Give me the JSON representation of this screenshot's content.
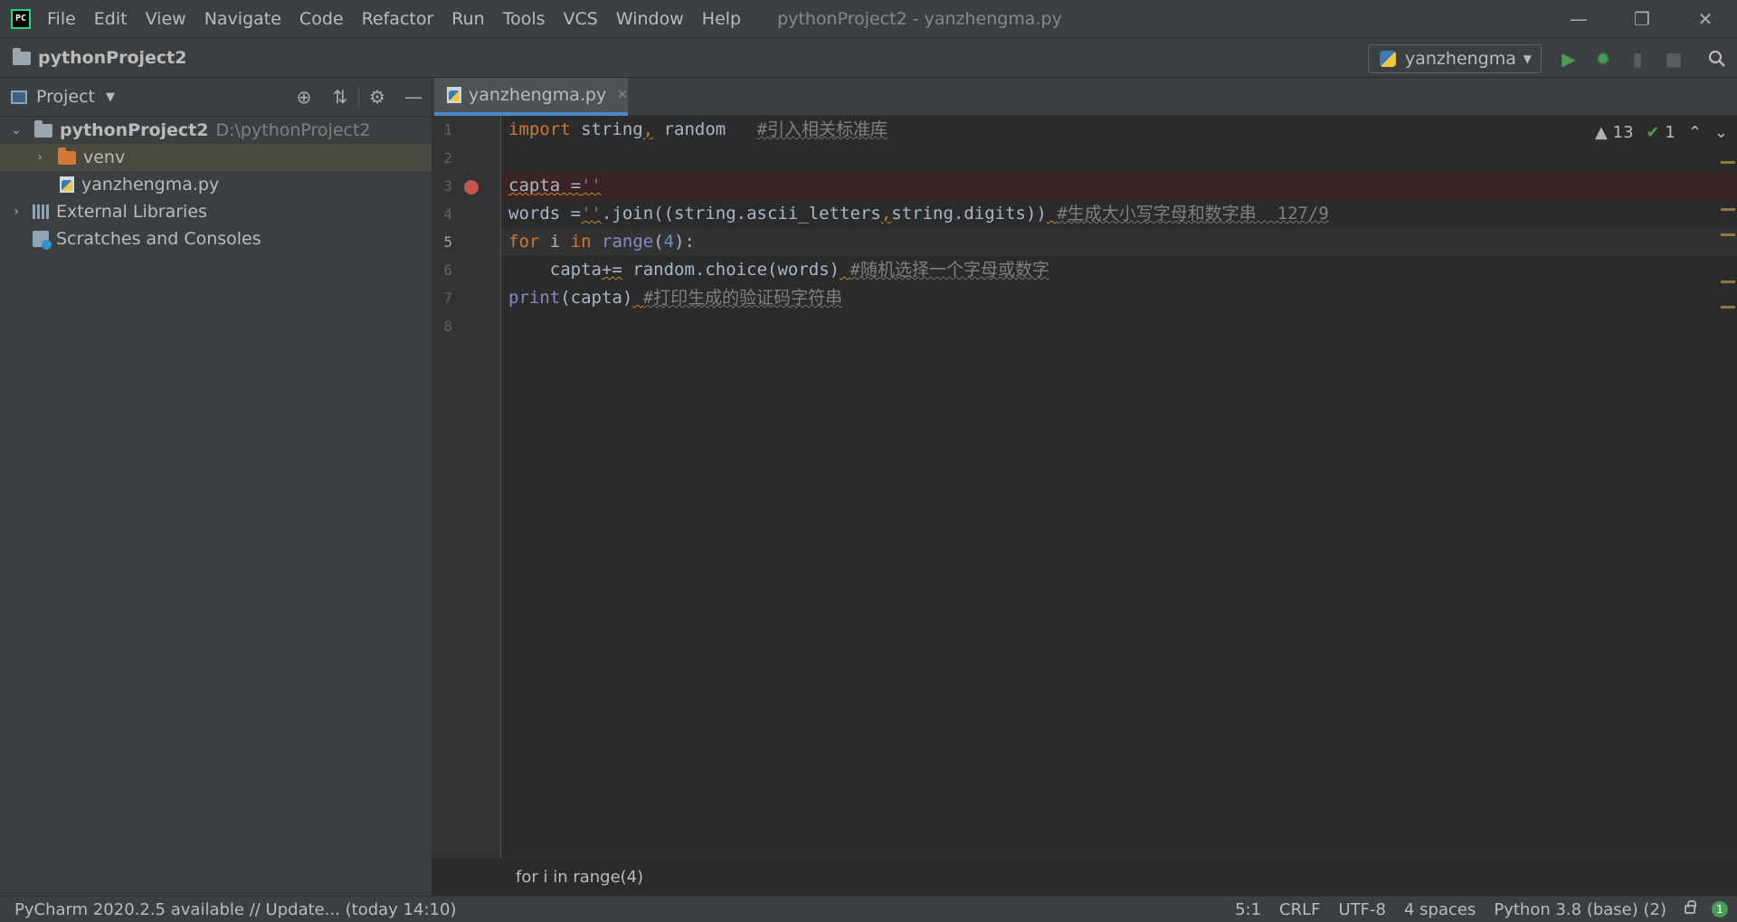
{
  "titlebar": {
    "logo": "PC",
    "menu": [
      "File",
      "Edit",
      "View",
      "Navigate",
      "Code",
      "Refactor",
      "Run",
      "Tools",
      "VCS",
      "Window",
      "Help"
    ],
    "window_title": "pythonProject2 - yanzhengma.py"
  },
  "navbar": {
    "breadcrumb": "pythonProject2",
    "run_config": "yanzhengma"
  },
  "project_panel": {
    "title": "Project",
    "tree": {
      "root_name": "pythonProject2",
      "root_path": "D:\\pythonProject2",
      "venv": "venv",
      "file": "yanzhengma.py",
      "external_libraries": "External Libraries",
      "scratches": "Scratches and Consoles"
    }
  },
  "editor": {
    "tab": "yanzhengma.py",
    "line_numbers": [
      "1",
      "2",
      "3",
      "4",
      "5",
      "6",
      "7",
      "8"
    ],
    "warnings_count": "13",
    "ok_count": "1",
    "code": {
      "l1": {
        "kw": "import",
        "mid": " string",
        "comma": ",",
        "rest": " random   ",
        "cmt": "#引入相关标准库"
      },
      "l3": {
        "a": "capta =",
        "b": "''"
      },
      "l4": {
        "a": "words =",
        "b": "''",
        "c": ".join((string.ascii_letters",
        "d": ",",
        "e": "string.digits))",
        "f": " ",
        "cmt": "#生成大小写字母和数字串  127/9"
      },
      "l5": {
        "kw1": "for",
        "a": " i ",
        "kw2": "in",
        "sp": " ",
        "bi": "range",
        "p1": "(",
        "num": "4",
        "p2": "):"
      },
      "l6": {
        "indent": "    ",
        "a": "capta",
        "op": "+=",
        "b": " random.choice(words)",
        "c": " ",
        "cmt": "#随机选择一个字母或数字"
      },
      "l7": {
        "bi": "print",
        "a": "(capta)",
        "b": " ",
        "cmt": "#打印生成的验证码字符串"
      }
    },
    "breadcrumb": "for i in range(4)"
  },
  "statusbar": {
    "message": "PyCharm 2020.2.5 available // Update... (today 14:10)",
    "position": "5:1",
    "line_sep": "CRLF",
    "encoding": "UTF-8",
    "indent": "4 spaces",
    "interpreter": "Python 3.8 (base) (2)",
    "events": "1"
  },
  "colors": {
    "accent": "#4a88c7",
    "keyword": "#cc7832",
    "builtin": "#8888c6",
    "number": "#6897bb",
    "string": "#6a8759",
    "comment": "#808080",
    "breakpoint": "#c75450",
    "run": "#499c54"
  }
}
